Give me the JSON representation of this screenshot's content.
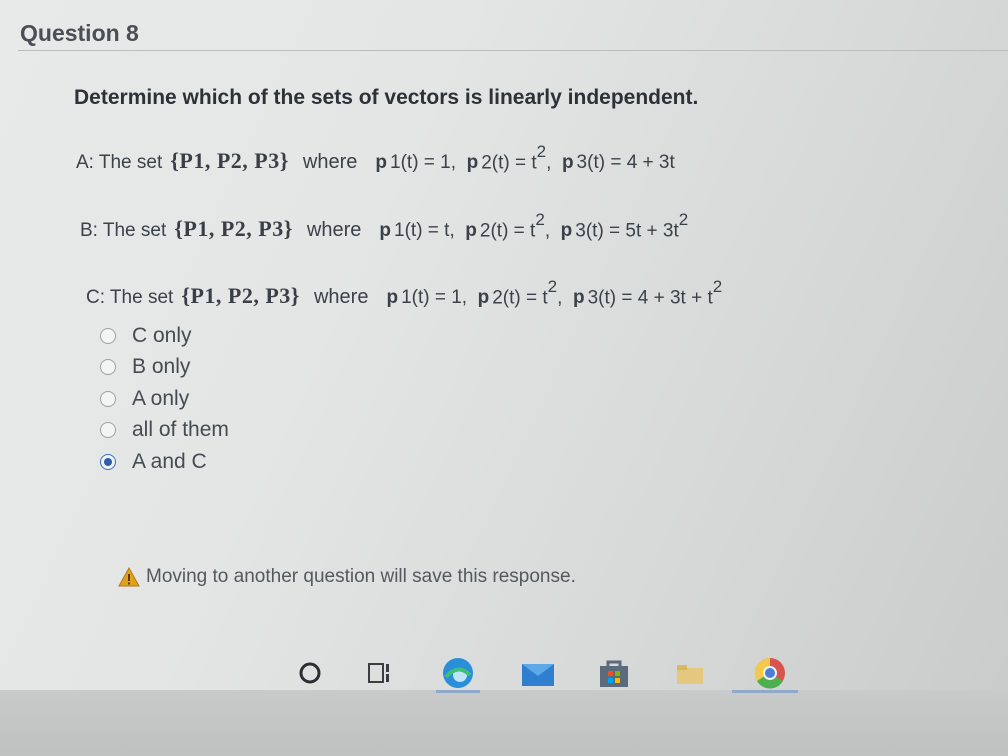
{
  "question": {
    "title": "Question 8",
    "prompt": "Determine which of the sets of vectors is linearly independent."
  },
  "sets": [
    {
      "label": "A: The set",
      "braced": "{P1, P2, P3}",
      "where": "where",
      "p1": "1(t) = 1,",
      "p2": "2(t) = t",
      "p2_exp": "2",
      "p3": "3(t) = 4 + 3t",
      "p3_exp": ""
    },
    {
      "label": "B: The set",
      "braced": "{P1, P2, P3}",
      "where": "where",
      "p1": "1(t) = t,",
      "p2": "2(t) = t",
      "p2_exp": "2",
      "p3": "3(t) = 5t + 3t",
      "p3_exp": "2"
    },
    {
      "label": "C: The set",
      "braced": "{P1, P2, P3}",
      "where": "where",
      "p1": "1(t) = 1,",
      "p2": "2(t) = t",
      "p2_exp": "2",
      "p3": "3(t) = 4 + 3t + t",
      "p3_exp": "2"
    }
  ],
  "formula_symbol": "p",
  "options": [
    {
      "label": "C only",
      "checked": false
    },
    {
      "label": "B only",
      "checked": false
    },
    {
      "label": "A only",
      "checked": false
    },
    {
      "label": "all of them",
      "checked": false
    },
    {
      "label": "A and C",
      "checked": true
    }
  ],
  "warning": "Moving to another question will save this response.",
  "taskbar_icons": [
    "search-icon",
    "task-view-icon",
    "edge-icon",
    "mail-icon",
    "store-icon",
    "files-icon",
    "chrome-icon"
  ],
  "colors": {
    "accent": "#2f5ea8",
    "warning": "#e0a21c"
  }
}
